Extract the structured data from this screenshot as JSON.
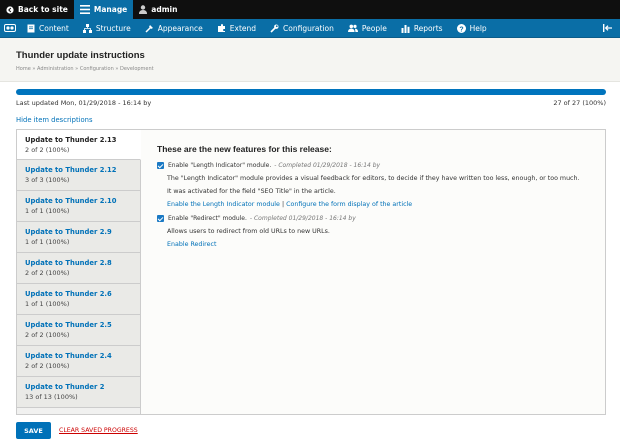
{
  "topbar": {
    "back_label": "Back to site",
    "manage_label": "Manage",
    "user_label": "admin"
  },
  "menu": [
    {
      "label": "Content",
      "icon": "content-icon"
    },
    {
      "label": "Structure",
      "icon": "structure-icon"
    },
    {
      "label": "Appearance",
      "icon": "appearance-icon"
    },
    {
      "label": "Extend",
      "icon": "extend-icon"
    },
    {
      "label": "Configuration",
      "icon": "configuration-icon"
    },
    {
      "label": "People",
      "icon": "people-icon"
    },
    {
      "label": "Reports",
      "icon": "reports-icon"
    },
    {
      "label": "Help",
      "icon": "help-icon"
    }
  ],
  "page": {
    "title": "Thunder update instructions",
    "breadcrumb": "Home » Administration » Configuration » Development"
  },
  "progress": {
    "fraction": 1.0,
    "last_updated": "Last updated Mon, 01/29/2018 - 16:14 by",
    "count": "27 of 27 (100%)"
  },
  "hide_descriptions": "Hide item descriptions",
  "tabs": [
    {
      "title": "Update to Thunder 2.13",
      "sub": "2 of 2 (100%)"
    },
    {
      "title": "Update to Thunder 2.12",
      "sub": "3 of 3 (100%)"
    },
    {
      "title": "Update to Thunder 2.10",
      "sub": "1 of 1 (100%)"
    },
    {
      "title": "Update to Thunder 2.9",
      "sub": "1 of 1 (100%)"
    },
    {
      "title": "Update to Thunder 2.8",
      "sub": "2 of 2 (100%)"
    },
    {
      "title": "Update to Thunder 2.6",
      "sub": "1 of 1 (100%)"
    },
    {
      "title": "Update to Thunder 2.5",
      "sub": "2 of 2 (100%)"
    },
    {
      "title": "Update to Thunder 2.4",
      "sub": "2 of 2 (100%)"
    },
    {
      "title": "Update to Thunder 2",
      "sub": "13 of 13 (100%)"
    }
  ],
  "content": {
    "heading": "These are the new features for this release:",
    "feature1": {
      "label": "Enable \"Length Indicator\" module.",
      "status": "- Completed 01/29/2018 - 16:14 by",
      "desc1": "The \"Length Indicator\" module provides a visual feedback for editors, to decide if they have written too less, enough, or too much.",
      "desc2": "It was activated for the field \"SEO Title\" in the article.",
      "link1": "Enable the Length Indicator module",
      "sep": "|",
      "link2": "Configure the form display of the article"
    },
    "feature2": {
      "label": "Enable \"Redirect\" module.",
      "status": "- Completed 01/29/2018 - 16:14 by",
      "desc1": "Allows users to redirect from old URLs to new URLs.",
      "link1": "Enable Redirect"
    }
  },
  "buttons": {
    "save": "SAVE",
    "clear": "CLEAR SAVED PROGRESS"
  },
  "colors": {
    "accent": "#0074bd",
    "toolbar": "#0a6ea6",
    "topbar": "#0f0f0f"
  }
}
